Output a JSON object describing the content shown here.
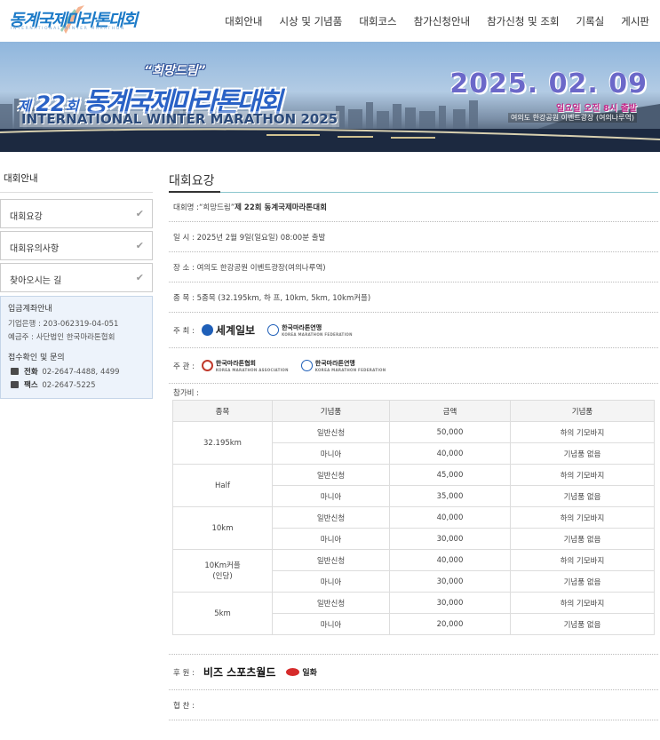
{
  "header": {
    "logo_main": "동계국제마라톤대회",
    "logo_sub": "INTERNATIONAL WINTER MARATHON",
    "nav": [
      "대회안내",
      "시상 및 기념품",
      "대회코스",
      "참가신청안내",
      "참가신청 및 조회",
      "기록실",
      "게시판"
    ]
  },
  "banner": {
    "slogan": "“희망드림”",
    "title_num_prefix": "제 ",
    "title_num": "22",
    "title_num_suffix": "회 ",
    "title_main": "동계국제마라톤대회",
    "title_eng": "INTERNATIONAL WINTER MARATHON 2025",
    "date": "2025. 02. 09",
    "when": "일요일 오전 8시 출발",
    "where": "여의도 한강공원 이벤트광장 (여의나루역)"
  },
  "sidebar": {
    "title": "대회안내",
    "menu": [
      "대회요강",
      "대회유의사항",
      "찾아오시는 길"
    ],
    "account_heading": "입금계좌안내",
    "bank": "기업은행 : 203-062319-04-051",
    "holder": "예금주 : 사단법인 한국마라톤협회",
    "contact_heading": "접수확인 및 문의",
    "phone_label": "전화",
    "phone": "02-2647-4488, 4499",
    "fax_label": "팩스",
    "fax": "02-2647-5225"
  },
  "main": {
    "page_title": "대회요강",
    "event_name_label": "대회명 : ",
    "event_name_slogan": "“희망드림” ",
    "event_name": "제 22회 동계국제마라톤대회",
    "datetime": "일 시 : 2025년 2월 9일(일요일) 08:00분 출발",
    "place": "장 소 : 여의도 한강공원 이벤트광장(여의나루역)",
    "events": "종 목 : 5종목 (32.195km, 하 프, 10km, 5km, 10km커플)",
    "host_label": "주 최 :",
    "host_1": "세계일보",
    "host_2": "한국마라톤연맹",
    "host_2_sub": "KOREA MARATHON FEDERATION",
    "organizer_label": "주 관 :",
    "org_1": "한국마라톤협회",
    "org_1_sub": "KOREA MARATHON ASSOCIATION",
    "org_2": "한국마라톤연맹",
    "org_2_sub": "KOREA MARATHON FEDERATION",
    "fee_label": "참가비 :",
    "sponsor_label": "후 원 :",
    "sponsor_1": "비즈 스포츠월드",
    "sponsor_2": "일화",
    "support_label": "협 찬 :"
  },
  "fee_table": {
    "headers": [
      "종목",
      "기념품",
      "금액",
      "기념품"
    ],
    "rows": [
      {
        "cat": "32.195km",
        "type1": "일반신청",
        "price1": "50,000",
        "gift1": "하의 기모바지",
        "type2": "마니아",
        "price2": "40,000",
        "gift2": "기념품 없음"
      },
      {
        "cat": "Half",
        "type1": "일반신청",
        "price1": "45,000",
        "gift1": "하의 기모바지",
        "type2": "마니아",
        "price2": "35,000",
        "gift2": "기념품 없음"
      },
      {
        "cat": "10km",
        "type1": "일반신청",
        "price1": "40,000",
        "gift1": "하의 기모바지",
        "type2": "마니아",
        "price2": "30,000",
        "gift2": "기념품 없음"
      },
      {
        "cat": "10Km커플",
        "cat2": "(인당)",
        "type1": "일반신청",
        "price1": "40,000",
        "gift1": "하의 기모바지",
        "type2": "마니아",
        "price2": "30,000",
        "gift2": "기념품 없음"
      },
      {
        "cat": "5km",
        "type1": "일반신청",
        "price1": "30,000",
        "gift1": "하의 기모바지",
        "type2": "마니아",
        "price2": "20,000",
        "gift2": "기념품 없음"
      }
    ]
  },
  "colors": {
    "brand_blue": "#1d7bc8",
    "title_underline": "#8cc6ce",
    "date_purple": "#6b68c9",
    "when_magenta": "#c22a8a",
    "sidebar_box": "#edf3fb"
  }
}
